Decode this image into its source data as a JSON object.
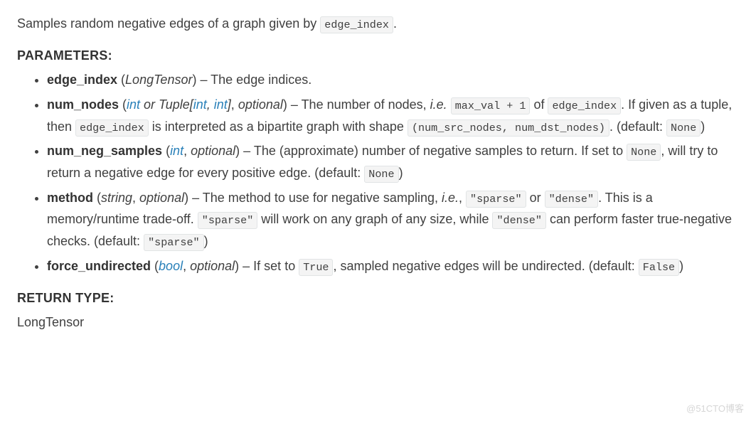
{
  "summary": {
    "prefix": "Samples random negative edges of a graph given by ",
    "code": "edge_index",
    "suffix": "."
  },
  "labels": {
    "parameters": "PARAMETERS:",
    "return_type": "RETURN TYPE:"
  },
  "params": {
    "edge_index": {
      "name": "edge_index",
      "type": "LongTensor",
      "desc": "The edge indices."
    },
    "num_nodes": {
      "name": "num_nodes",
      "type_int": "int",
      "type_or": " or Tuple[",
      "type_int2": "int",
      "type_comma": ", ",
      "type_int3": "int",
      "type_close": "]",
      "optional": "optional",
      "desc_pre": "The number of nodes, ",
      "ie": "i.e.",
      "code_maxval": "max_val + 1",
      "desc_of": " of ",
      "code_edgeindex": "edge_index",
      "desc_iftuple": ". If given as a tuple, then ",
      "code_edgeindex2": "edge_index",
      "desc_bipartite": " is interpreted as a bipartite graph with shape ",
      "code_shape": "(num_src_nodes, num_dst_nodes)",
      "desc_default_pre": ". (default: ",
      "code_none": "None",
      "desc_default_post": ")"
    },
    "num_neg_samples": {
      "name": "num_neg_samples",
      "type_int": "int",
      "optional": "optional",
      "desc_pre": "The (approximate) number of negative samples to return. If set to ",
      "code_none": "None",
      "desc_mid": ", will try to return a negative edge for every positive edge. (default: ",
      "code_none2": "None",
      "desc_post": ")"
    },
    "method": {
      "name": "method",
      "type_string": "string",
      "optional": "optional",
      "desc_pre": "The method to use for negative sampling, ",
      "ie": "i.e.",
      "comma": ", ",
      "code_sparse": "\"sparse\"",
      "or": " or ",
      "code_dense": "\"dense\"",
      "desc_tradeoff": ". This is a memory/runtime trade-off. ",
      "code_sparse2": "\"sparse\"",
      "desc_sparse": " will work on any graph of any size, while ",
      "code_dense2": "\"dense\"",
      "desc_dense": " can perform faster true-negative checks. (default: ",
      "code_default": "\"sparse\"",
      "desc_post": ")"
    },
    "force_undirected": {
      "name": "force_undirected",
      "type_bool": "bool",
      "optional": "optional",
      "desc_pre": "If set to ",
      "code_true": "True",
      "desc_mid": ", sampled negative edges will be undirected. (default: ",
      "code_false": "False",
      "desc_post": ")"
    }
  },
  "return_type": "LongTensor",
  "watermark": "@51CTO博客"
}
